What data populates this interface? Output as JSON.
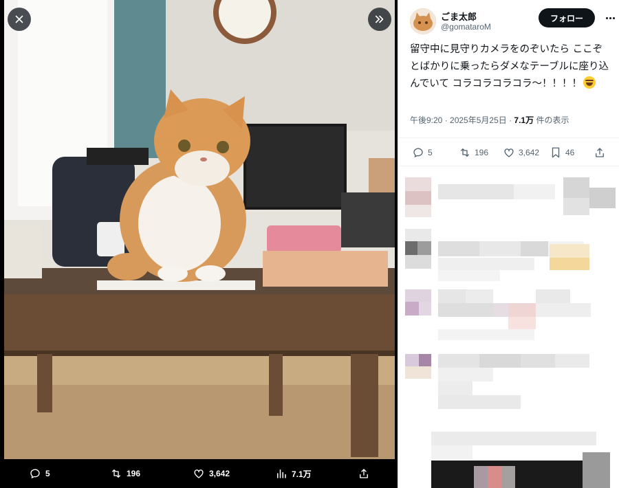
{
  "media": {
    "close_icon": "close-icon",
    "next_icon": "double-chevron-right-icon",
    "bar": {
      "reply_count": "5",
      "retweet_count": "196",
      "like_count": "3,642",
      "view_count": "7.1万"
    }
  },
  "tweet": {
    "author": {
      "display_name": "ごま太郎",
      "handle": "@gomataroM"
    },
    "follow_label": "フォロー",
    "text": "留守中に見守りカメラをのぞいたら ここぞとばかりに乗ったらダメなテーブルに座り込んでいて コラコラコラコラ〜！！！！",
    "meta": {
      "time": "午後9:20",
      "separator": " · ",
      "date": "2025年5月25日",
      "views_count": "7.1万",
      "views_label": " 件の表示"
    },
    "actions": {
      "reply_count": "5",
      "retweet_count": "196",
      "like_count": "3,642",
      "bookmark_count": "46"
    }
  },
  "colors": {
    "text": "#0f1419",
    "secondary": "#536471",
    "follow_bg": "#0f1419"
  }
}
